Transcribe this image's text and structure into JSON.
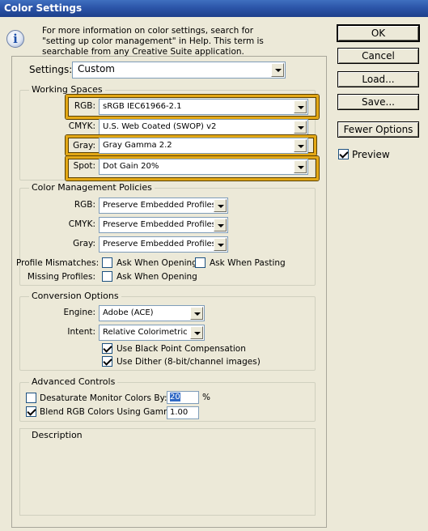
{
  "window": {
    "title": "Color Settings"
  },
  "info": {
    "text": "For more information on color settings, search for \"setting up color management\" in Help. This term is searchable from any Creative Suite application."
  },
  "settings": {
    "label": "Settings:",
    "value": "Custom"
  },
  "working_spaces": {
    "legend": "Working Spaces",
    "rgb": {
      "label": "RGB:",
      "value": "sRGB IEC61966-2.1"
    },
    "cmyk": {
      "label": "CMYK:",
      "value": "U.S. Web Coated (SWOP) v2"
    },
    "gray": {
      "label": "Gray:",
      "value": "Gray Gamma 2.2"
    },
    "spot": {
      "label": "Spot:",
      "value": "Dot Gain 20%"
    }
  },
  "policies": {
    "legend": "Color Management Policies",
    "rgb": {
      "label": "RGB:",
      "value": "Preserve Embedded Profiles"
    },
    "cmyk": {
      "label": "CMYK:",
      "value": "Preserve Embedded Profiles"
    },
    "gray": {
      "label": "Gray:",
      "value": "Preserve Embedded Profiles"
    },
    "mismatches_label": "Profile Mismatches:",
    "ask_opening": "Ask When Opening",
    "ask_pasting": "Ask When Pasting",
    "missing_label": "Missing Profiles:",
    "missing_ask_opening": "Ask When Opening"
  },
  "conversion": {
    "legend": "Conversion Options",
    "engine": {
      "label": "Engine:",
      "value": "Adobe (ACE)"
    },
    "intent": {
      "label": "Intent:",
      "value": "Relative Colorimetric"
    },
    "black_point": {
      "label": "Use Black Point Compensation",
      "checked": true
    },
    "dither": {
      "label": "Use Dither (8-bit/channel images)",
      "checked": true
    }
  },
  "advanced": {
    "legend": "Advanced Controls",
    "desaturate": {
      "label": "Desaturate Monitor Colors By:",
      "checked": false,
      "value": "20",
      "unit": "%"
    },
    "blend": {
      "label": "Blend RGB Colors Using Gamma:",
      "checked": true,
      "value": "1.00"
    }
  },
  "description": {
    "legend": "Description"
  },
  "buttons": {
    "ok": "OK",
    "cancel": "Cancel",
    "load": "Load...",
    "save": "Save...",
    "fewer_options": "Fewer Options"
  },
  "preview": {
    "label": "Preview",
    "checked": true
  },
  "colors": {
    "highlight": "#e3a816",
    "titlebar": "#2c55a9",
    "dialog_bg": "#ece9d8"
  }
}
